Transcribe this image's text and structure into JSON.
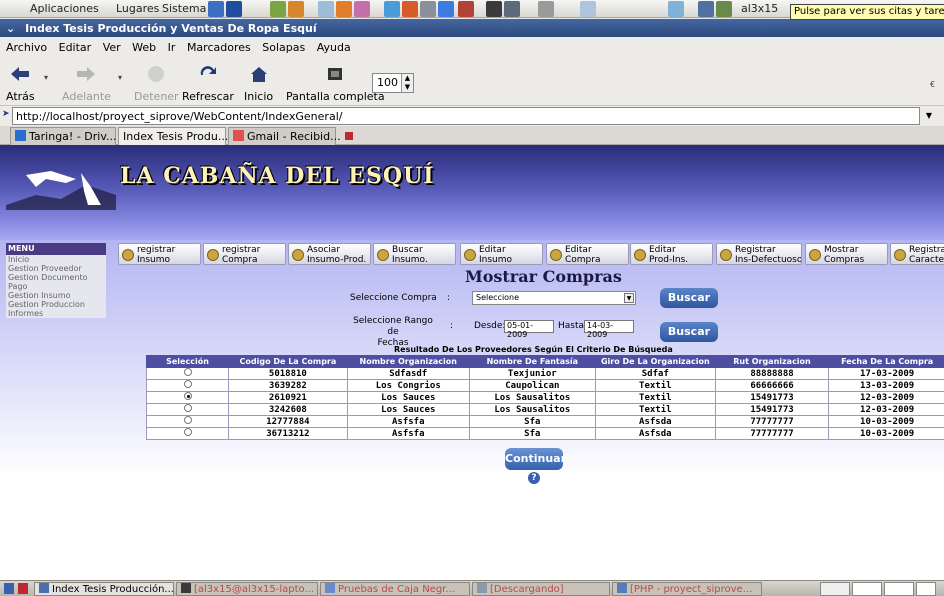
{
  "panel": {
    "menus": [
      "Aplicaciones",
      "Lugares",
      "Sistema"
    ],
    "user": "al3x15",
    "tooltip": "Pulse para ver sus citas y tareas"
  },
  "window": {
    "title": "Index Tesis Producción y Ventas De Ropa Esquí"
  },
  "menubar": [
    "Archivo",
    "Editar",
    "Ver",
    "Web",
    "Ir",
    "Marcadores",
    "Solapas",
    "Ayuda"
  ],
  "toolbar": {
    "back": "Atrás",
    "forward": "Adelante",
    "stop": "Detener",
    "reload": "Refrescar",
    "home": "Inicio",
    "fullscreen": "Pantalla completa",
    "zoom": "100"
  },
  "address": {
    "url": "http://localhost/proyect_siprove/WebContent/IndexGeneral/"
  },
  "tabs": [
    {
      "label": "Taringa! - Driv..."
    },
    {
      "label": "Index Tesis Produ..."
    },
    {
      "label": "Gmail - Recibid..."
    }
  ],
  "site": {
    "logo": "LA CABAÑA DEL ESQUÍ"
  },
  "sidemenu": {
    "title": "MENU",
    "items": [
      "Inicio",
      "Gestion Proveedor",
      "Gestion Documento Pago",
      "Gestion Insumo",
      "Gestion Produccion",
      "Informes"
    ]
  },
  "navbuttons": [
    {
      "l1": "registrar",
      "l2": "Insumo"
    },
    {
      "l1": "registrar",
      "l2": "Compra"
    },
    {
      "l1": "Asociar",
      "l2": "Insumo-Prod."
    },
    {
      "l1": "Buscar",
      "l2": "Insumo."
    },
    {
      "l1": "Editar",
      "l2": "Insumo"
    },
    {
      "l1": "Editar",
      "l2": "Compra"
    },
    {
      "l1": "Editar",
      "l2": "Prod-Ins."
    },
    {
      "l1": "Registrar",
      "l2": "Ins-Defectuoso."
    },
    {
      "l1": "Mostrar",
      "l2": "Compras"
    },
    {
      "l1": "Registra",
      "l2": "Caracter"
    }
  ],
  "form": {
    "title": "Mostrar Compras",
    "select_label": "Seleccione Compra",
    "colon": ":",
    "select_value": "Seleccione",
    "range_label_1": "Seleccione Rango de",
    "range_label_2": "Fechas",
    "desde_label": "Desde:",
    "desde_value": "05-01-2009",
    "hasta_label": "Hasta:",
    "hasta_value": "14-03-2009",
    "buscar": "Buscar"
  },
  "results": {
    "caption": "Resultado De Los Proveedores Según El Criterio De Búsqueda",
    "headers": [
      "Selección",
      "Codigo De La Compra",
      "Nombre Organizacion",
      "Nombre De Fantasía",
      "Giro De La Organizacion",
      "Rut Organizacion",
      "Fecha De La Compra"
    ],
    "rows": [
      {
        "selected": false,
        "codigo": "5018810",
        "org": "Sdfasdf",
        "fantasia": "Texjunior",
        "giro": "Sdfaf",
        "rut": "88888888",
        "fecha": "17-03-2009"
      },
      {
        "selected": false,
        "codigo": "3639282",
        "org": "Los Congrios",
        "fantasia": "Caupolican",
        "giro": "Textil",
        "rut": "66666666",
        "fecha": "13-03-2009"
      },
      {
        "selected": true,
        "codigo": "2610921",
        "org": "Los Sauces",
        "fantasia": "Los Sausalitos",
        "giro": "Textil",
        "rut": "15491773",
        "fecha": "12-03-2009"
      },
      {
        "selected": false,
        "codigo": "3242608",
        "org": "Los Sauces",
        "fantasia": "Los Sausalitos",
        "giro": "Textil",
        "rut": "15491773",
        "fecha": "12-03-2009"
      },
      {
        "selected": false,
        "codigo": "12777884",
        "org": "Asfsfa",
        "fantasia": "Sfa",
        "giro": "Asfsda",
        "rut": "77777777",
        "fecha": "10-03-2009"
      },
      {
        "selected": false,
        "codigo": "36713212",
        "org": "Asfsfa",
        "fantasia": "Sfa",
        "giro": "Asfsda",
        "rut": "77777777",
        "fecha": "10-03-2009"
      }
    ],
    "continuar": "Continuar",
    "help": "?"
  },
  "taskbar": [
    {
      "label": "Index Tesis Producción..."
    },
    {
      "label": "[al3x15@al3x15-lapto..."
    },
    {
      "label": "Pruebas de Caja Negr..."
    },
    {
      "label": "[Descargando]"
    },
    {
      "label": "[PHP - proyect_siprove..."
    }
  ]
}
